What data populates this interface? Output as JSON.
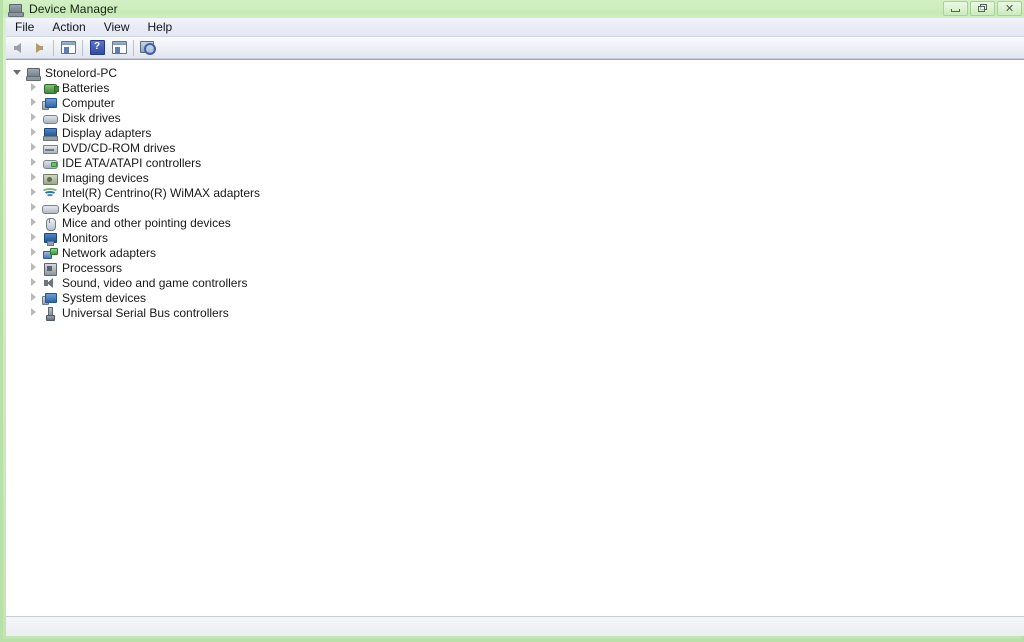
{
  "window": {
    "title": "Device Manager",
    "title_icon": "device-manager-icon",
    "controls": [
      {
        "name": "minimize-button",
        "glyph": "—",
        "label": "Minimize"
      },
      {
        "name": "restore-button",
        "glyph": "❐",
        "label": "Restore"
      },
      {
        "name": "close-button",
        "glyph": "✕",
        "label": "Close"
      }
    ]
  },
  "menu": {
    "items": [
      {
        "label": "File",
        "name": "menu-file"
      },
      {
        "label": "Action",
        "name": "menu-action"
      },
      {
        "label": "View",
        "name": "menu-view"
      },
      {
        "label": "Help",
        "name": "menu-help"
      }
    ]
  },
  "toolbar": {
    "buttons": [
      {
        "name": "back-button",
        "icon": "arrow-left-icon",
        "label": "Back"
      },
      {
        "name": "forward-button",
        "icon": "arrow-right-icon",
        "label": "Forward"
      },
      {
        "name": "show-hide-console-tree-button",
        "icon": "console-tree-icon",
        "label": "Show/Hide Console Tree"
      },
      {
        "name": "help-button",
        "icon": "help-question-icon",
        "label": "Help"
      },
      {
        "name": "properties-button",
        "icon": "properties-panel-icon",
        "label": "Properties"
      },
      {
        "name": "scan-hardware-changes-button",
        "icon": "scan-hardware-icon",
        "label": "Scan for hardware changes"
      }
    ]
  },
  "tree": {
    "root": {
      "label": "Stonelord-PC",
      "icon": "computer-icon",
      "expanded": true
    },
    "items": [
      {
        "label": "Batteries",
        "icon": "battery-icon",
        "expanded": false
      },
      {
        "label": "Computer",
        "icon": "computer-node-icon",
        "expanded": false
      },
      {
        "label": "Disk drives",
        "icon": "disk-drive-icon",
        "expanded": false
      },
      {
        "label": "Display adapters",
        "icon": "display-adapter-icon",
        "expanded": false
      },
      {
        "label": "DVD/CD-ROM drives",
        "icon": "dvd-drive-icon",
        "expanded": false
      },
      {
        "label": "IDE ATA/ATAPI controllers",
        "icon": "ide-controller-icon",
        "expanded": false
      },
      {
        "label": "Imaging devices",
        "icon": "imaging-device-icon",
        "expanded": false
      },
      {
        "label": "Intel(R) Centrino(R) WiMAX adapters",
        "icon": "wimax-adapter-icon",
        "expanded": false
      },
      {
        "label": "Keyboards",
        "icon": "keyboard-icon",
        "expanded": false
      },
      {
        "label": "Mice and other pointing devices",
        "icon": "mouse-icon",
        "expanded": false
      },
      {
        "label": "Monitors",
        "icon": "monitor-icon",
        "expanded": false
      },
      {
        "label": "Network adapters",
        "icon": "network-adapter-icon",
        "expanded": false
      },
      {
        "label": "Processors",
        "icon": "processor-icon",
        "expanded": false
      },
      {
        "label": "Sound, video and game controllers",
        "icon": "sound-controller-icon",
        "expanded": false
      },
      {
        "label": "System devices",
        "icon": "system-device-icon",
        "expanded": false
      },
      {
        "label": "Universal Serial Bus controllers",
        "icon": "usb-controller-icon",
        "expanded": false
      }
    ]
  },
  "statusbar": {
    "text": ""
  },
  "colors": {
    "titlebar_start": "#d2f0c4",
    "titlebar_end": "#c2e6b2",
    "frame": "#b9e0a8",
    "toolbar_bg": "#eef1f7",
    "content_bg": "#ffffff",
    "text": "#181818"
  }
}
